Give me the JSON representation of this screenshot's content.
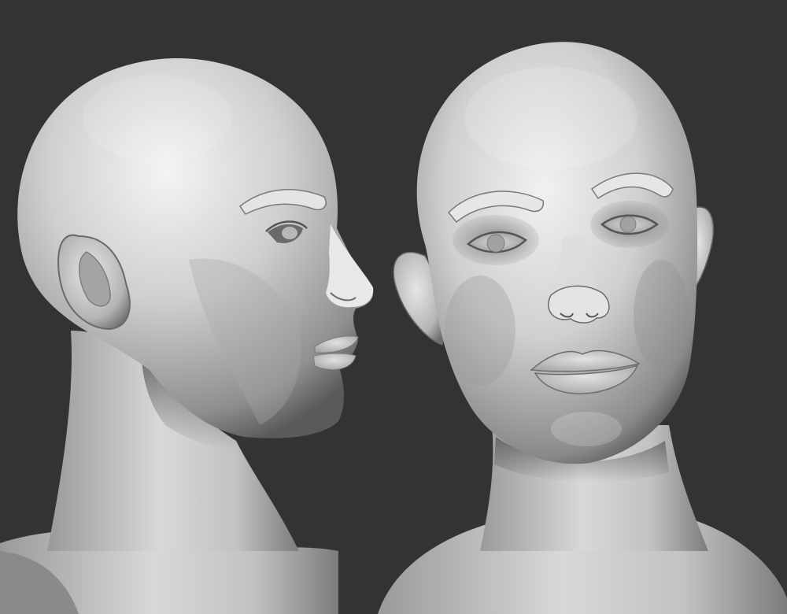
{
  "scene": {
    "background_color": "#333333",
    "material_color": "#c9c9c9",
    "shadow_color": "#3a3a3a",
    "highlight_color": "#f4f4f4",
    "subjects": [
      {
        "name": "profile-head-sculpt",
        "view": "side"
      },
      {
        "name": "front-head-sculpt",
        "view": "front"
      }
    ]
  }
}
